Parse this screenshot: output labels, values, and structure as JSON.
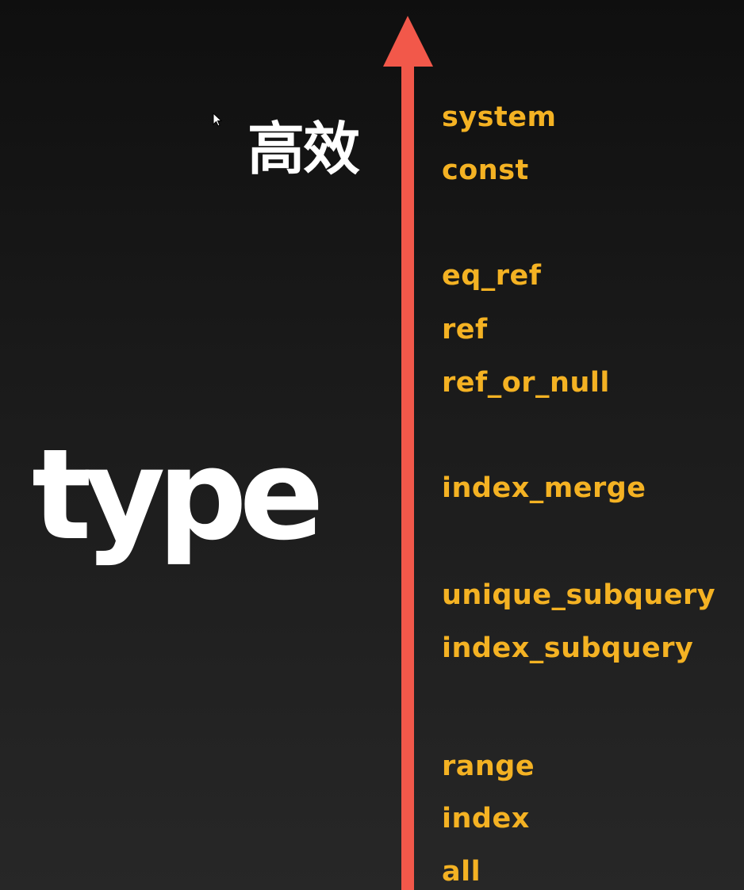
{
  "title_zh": "高效",
  "main_label": "type",
  "levels": [
    "system",
    "const",
    "eq_ref",
    "ref",
    "ref_or_null",
    "index_merge",
    "unique_subquery",
    "index_subquery",
    "range",
    "index",
    "all"
  ],
  "colors": {
    "arrow": "#f2584a",
    "level_text": "#f4b223",
    "title_text": "#ffffff"
  },
  "icons": {
    "arrow": "up-arrow-icon",
    "cursor": "mouse-cursor-icon"
  }
}
